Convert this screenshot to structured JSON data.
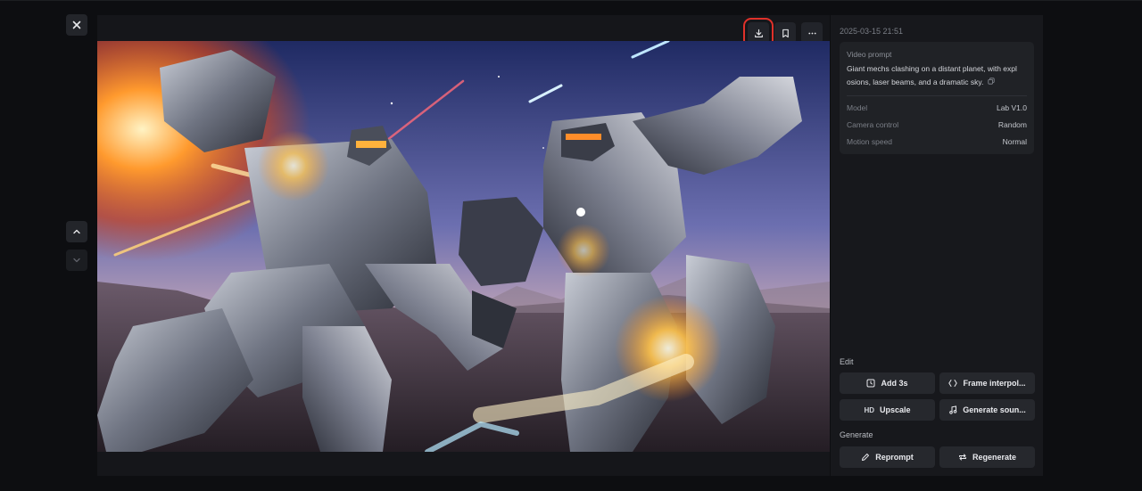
{
  "viewer": {
    "close_icon": "close-icon",
    "nav_up_icon": "chevron-up-icon",
    "nav_down_icon": "chevron-down-icon",
    "toolbar": {
      "download_icon": "download-icon",
      "bookmark_icon": "bookmark-icon",
      "more_icon": "more-horizontal-icon"
    },
    "media_description_icon": "image-placeholder"
  },
  "details": {
    "timestamp": "2025-03-15 21:51",
    "prompt_label": "Video prompt",
    "prompt_line1": "Giant mechs clashing on a distant planet, with expl",
    "prompt_line2": "osions, laser beams, and a dramatic sky.",
    "meta": [
      {
        "key": "Model",
        "value": "Lab V1.0"
      },
      {
        "key": "Camera control",
        "value": "Random"
      },
      {
        "key": "Motion speed",
        "value": "Normal"
      }
    ]
  },
  "edit": {
    "title": "Edit",
    "buttons": [
      {
        "label": "Add 3s",
        "icon": "add-time-icon"
      },
      {
        "label": "Frame interpol...",
        "icon": "diamond-frames-icon"
      },
      {
        "label": "Upscale",
        "icon": "hd-icon",
        "icon_text": "HD"
      },
      {
        "label": "Generate soun...",
        "icon": "music-note-icon"
      }
    ]
  },
  "generate": {
    "title": "Generate",
    "buttons": [
      {
        "label": "Reprompt",
        "icon": "pencil-icon"
      },
      {
        "label": "Regenerate",
        "icon": "repeat-icon"
      }
    ]
  },
  "colors": {
    "background": "#0d0e11",
    "panel": "#17181c",
    "card": "#202226",
    "button": "#26282d",
    "highlight": "#e0312a"
  }
}
